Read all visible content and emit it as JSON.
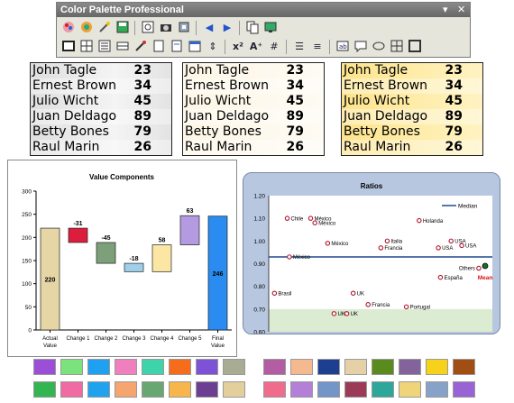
{
  "toolbar": {
    "title": "Color Palette Professional",
    "row1_icons": [
      "palette-icon",
      "color-wheel-icon",
      "magic-wand-icon",
      "save-icon",
      "chart-view-icon",
      "camera-icon",
      "settings-icon",
      "arrow-left-icon",
      "arrow-right-icon",
      "copy-icon",
      "monitor-icon"
    ],
    "row2_icons": [
      "window-icon",
      "grid-icon",
      "list-icon",
      "table-icon",
      "eyedropper-icon",
      "document-icon",
      "page-icon",
      "calendar-icon",
      "row-height-icon",
      "superscript-icon",
      "text-size-icon",
      "grid-lines-icon",
      "bullets-icon",
      "align-icon",
      "text-box-icon",
      "comment-icon",
      "ellipse-icon",
      "border-grid-icon",
      "frame-icon"
    ]
  },
  "tables": [
    {
      "rows": [
        {
          "name": "John Tagle",
          "value": "23"
        },
        {
          "name": "Ernest Brown",
          "value": "34"
        },
        {
          "name": "Julio Wicht",
          "value": "45"
        },
        {
          "name": "Juan Deldago",
          "value": "89"
        },
        {
          "name": "Betty Bones",
          "value": "79"
        },
        {
          "name": "Raul Marin",
          "value": "26"
        }
      ]
    },
    {
      "rows": [
        {
          "name": "John Tagle",
          "value": "23"
        },
        {
          "name": "Ernest Brown",
          "value": "34"
        },
        {
          "name": "Julio Wicht",
          "value": "45"
        },
        {
          "name": "Juan Deldago",
          "value": "89"
        },
        {
          "name": "Betty Bones",
          "value": "79"
        },
        {
          "name": "Raul Marin",
          "value": "26"
        }
      ]
    },
    {
      "rows": [
        {
          "name": "John Tagle",
          "value": "23"
        },
        {
          "name": "Ernest Brown",
          "value": "34"
        },
        {
          "name": "Julio Wicht",
          "value": "45"
        },
        {
          "name": "Juan Deldago",
          "value": "89"
        },
        {
          "name": "Betty Bones",
          "value": "79"
        },
        {
          "name": "Raul Marin",
          "value": "26"
        }
      ]
    }
  ],
  "chart_data": [
    {
      "type": "bar",
      "title": "Value Components",
      "categories": [
        "Actual Value",
        "Change 1",
        "Change 2",
        "Change 3",
        "Change 4",
        "Change 5",
        "Final Value"
      ],
      "category_lines": [
        [
          "Actual",
          "Value"
        ],
        [
          "Change 1"
        ],
        [
          "Change 2"
        ],
        [
          "Change 3"
        ],
        [
          "Change 4"
        ],
        [
          "Change 5"
        ],
        [
          "Final",
          "Value"
        ]
      ],
      "values": [
        220,
        -31,
        -45,
        -18,
        58,
        63,
        246
      ],
      "labels": [
        "220",
        "-31",
        "-45",
        "-18",
        "58",
        "63",
        "246"
      ],
      "colors": [
        "#e6d6a6",
        "#dc1e3c",
        "#7da07a",
        "#9ed0ea",
        "#fbe6a4",
        "#b49ae0",
        "#2a8cf0"
      ],
      "ylim": [
        0,
        300
      ],
      "yticks": [
        0,
        50,
        100,
        150,
        200,
        250,
        300
      ],
      "grid": false
    },
    {
      "type": "scatter",
      "title": "Ratios",
      "ylim": [
        0.6,
        1.2
      ],
      "yticks": [
        "0.60",
        "0.70",
        "0.80",
        "0.90",
        "1.00",
        "1.10",
        "1.20"
      ],
      "median": 0.93,
      "median_label": "Median",
      "points": [
        {
          "label": "Chile",
          "x": 0.07,
          "y": 1.1
        },
        {
          "label": "México",
          "x": 0.18,
          "y": 1.1
        },
        {
          "label": "México",
          "x": 0.2,
          "y": 1.08
        },
        {
          "label": "Holanda",
          "x": 0.69,
          "y": 1.09
        },
        {
          "label": "México",
          "x": 0.08,
          "y": 0.93
        },
        {
          "label": "México",
          "x": 0.26,
          "y": 0.99
        },
        {
          "label": "Italia",
          "x": 0.54,
          "y": 1.0
        },
        {
          "label": "Francia",
          "x": 0.51,
          "y": 0.97
        },
        {
          "label": "USA",
          "x": 0.84,
          "y": 1.0
        },
        {
          "label": "USA",
          "x": 0.89,
          "y": 0.98
        },
        {
          "label": "USA",
          "x": 0.78,
          "y": 0.97
        },
        {
          "label": "Others",
          "x": 0.97,
          "y": 0.88
        },
        {
          "label": "España",
          "x": 0.79,
          "y": 0.84
        },
        {
          "label": "Brasil",
          "x": 0.01,
          "y": 0.77
        },
        {
          "label": "UK",
          "x": 0.38,
          "y": 0.77
        },
        {
          "label": "Francia",
          "x": 0.45,
          "y": 0.72
        },
        {
          "label": "Portugal",
          "x": 0.63,
          "y": 0.71
        },
        {
          "label": "UK",
          "x": 0.29,
          "y": 0.68
        },
        {
          "label": "UK",
          "x": 0.35,
          "y": 0.68
        }
      ],
      "mean": {
        "label": "Mean",
        "x": 1.0,
        "y": 0.89
      }
    }
  ],
  "swatches": {
    "left": [
      [
        "#9b4fd6",
        "#7be37d",
        "#1fa0f0",
        "#f07fbe",
        "#3ed3ab",
        "#f56c1c",
        "#7e52d7",
        "#a8ac92"
      ],
      [
        "#33b552",
        "#f06aa3",
        "#1fa3ef",
        "#f5a56d",
        "#68a672",
        "#f6b64b",
        "#6d3f92",
        "#e2cf9c"
      ]
    ],
    "right": [
      [
        "#b35da3",
        "#f5b990",
        "#1e3f8f",
        "#e5d0a7",
        "#5b8a1e",
        "#83639c",
        "#f7d21b",
        "#a04e14"
      ],
      [
        "#f06c8c",
        "#b37fd7",
        "#7395c8",
        "#9b3b58",
        "#2da79a",
        "#f0d47a",
        "#87a2c9",
        "#9a63d5"
      ]
    ]
  }
}
